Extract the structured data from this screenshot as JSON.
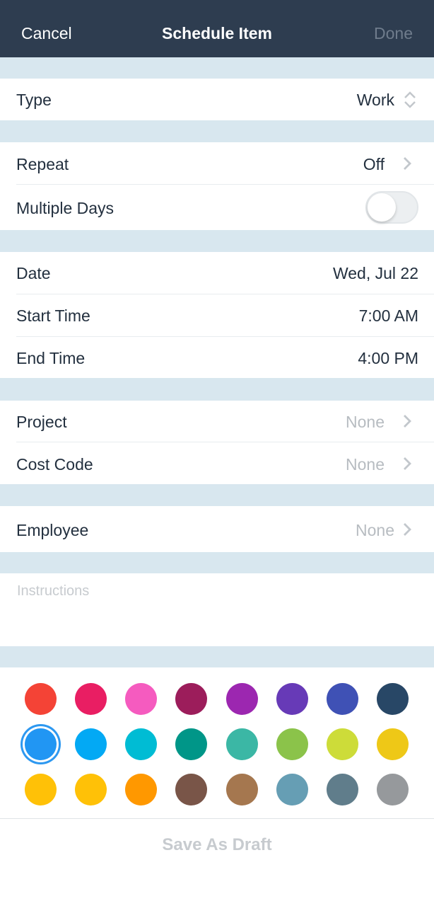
{
  "nav": {
    "cancel": "Cancel",
    "title": "Schedule Item",
    "done": "Done"
  },
  "type_row": {
    "label": "Type",
    "value": "Work",
    "icon": "updown-chevron-icon"
  },
  "repeat_row": {
    "label": "Repeat",
    "value": "Off",
    "icon": "chevron-right-icon"
  },
  "multiple_days_row": {
    "label": "Multiple Days",
    "toggle_on": false
  },
  "date_row": {
    "label": "Date",
    "value": "Wed, Jul 22"
  },
  "start_row": {
    "label": "Start Time",
    "value": "7:00 AM"
  },
  "end_row": {
    "label": "End Time",
    "value": "4:00 PM"
  },
  "project_row": {
    "label": "Project",
    "value": "None",
    "icon": "chevron-right-icon"
  },
  "cost_code_row": {
    "label": "Cost Code",
    "value": "None",
    "icon": "chevron-right-icon"
  },
  "employee_row": {
    "label": "Employee",
    "value": "None",
    "icon": "chevron-right-icon"
  },
  "instructions": {
    "placeholder": "Instructions"
  },
  "colors": {
    "selected_index": 8,
    "swatches": [
      "#f44336",
      "#e91e63",
      "#f55bbf",
      "#9c1d5b",
      "#9c27b0",
      "#673ab7",
      "#3f51b5",
      "#284766",
      "#2196f3",
      "#03a9f4",
      "#00bcd4",
      "#009688",
      "#3bb7a5",
      "#8bc34a",
      "#cddc39",
      "#eec817",
      "#ffc107",
      "#ffc107",
      "#ff9800",
      "#795548",
      "#a5774f",
      "#669eb4",
      "#607d8b",
      "#96999c"
    ]
  },
  "footer": {
    "save_draft": "Save As Draft"
  },
  "theme": {
    "navbar": "#2e3d50",
    "section_bg": "#d8e7ef",
    "muted_text": "#b7bcc1",
    "accent": "#2d98f0"
  }
}
